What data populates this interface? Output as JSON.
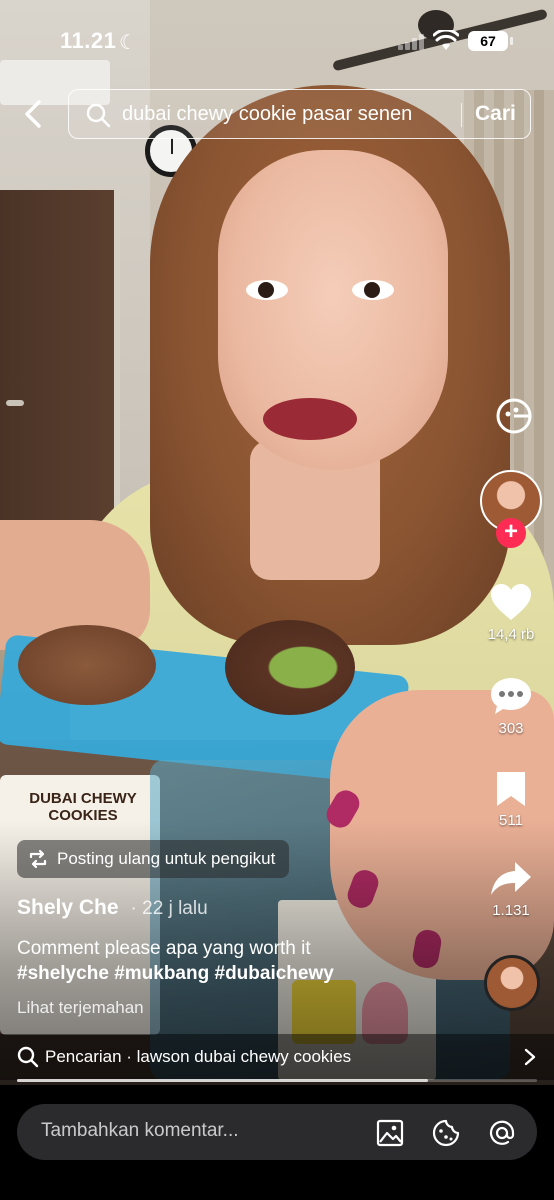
{
  "status_bar": {
    "time": "11.21",
    "battery": "67"
  },
  "search": {
    "query": "dubai chewy cookie pasar senen",
    "submit_label": "Cari"
  },
  "video_text": {
    "box_label": "DUBAI CHEWY COOKIES"
  },
  "actions": {
    "likes": "14,4 rb",
    "comments": "303",
    "saves": "511",
    "shares": "1.131"
  },
  "post": {
    "repost_label": "Posting ulang untuk pengikut",
    "author": "Shely Che",
    "time_ago": "· 22 j lalu",
    "caption_text": "Comment please apa yang worth it",
    "hashtags": [
      "#shelyche",
      "#mukbang",
      "#dubaichewy"
    ],
    "translate_label": "Lihat terjemahan"
  },
  "related_search": {
    "label": "Pencarian · lawson dubai chewy cookies"
  },
  "playback": {
    "progress": 0.79
  },
  "comment_bar": {
    "placeholder": "Tambahkan komentar..."
  },
  "icons": {
    "back": "chevron-left-icon",
    "search": "search-icon",
    "effect": "effect-icon",
    "like": "heart-icon",
    "comment": "comment-icon",
    "save": "bookmark-icon",
    "share": "share-icon",
    "image": "image-icon",
    "emoji": "emoji-icon",
    "mention": "at-icon"
  },
  "colors": {
    "follow": "#fe2c55",
    "comment_bar": "#2b2b2d"
  }
}
